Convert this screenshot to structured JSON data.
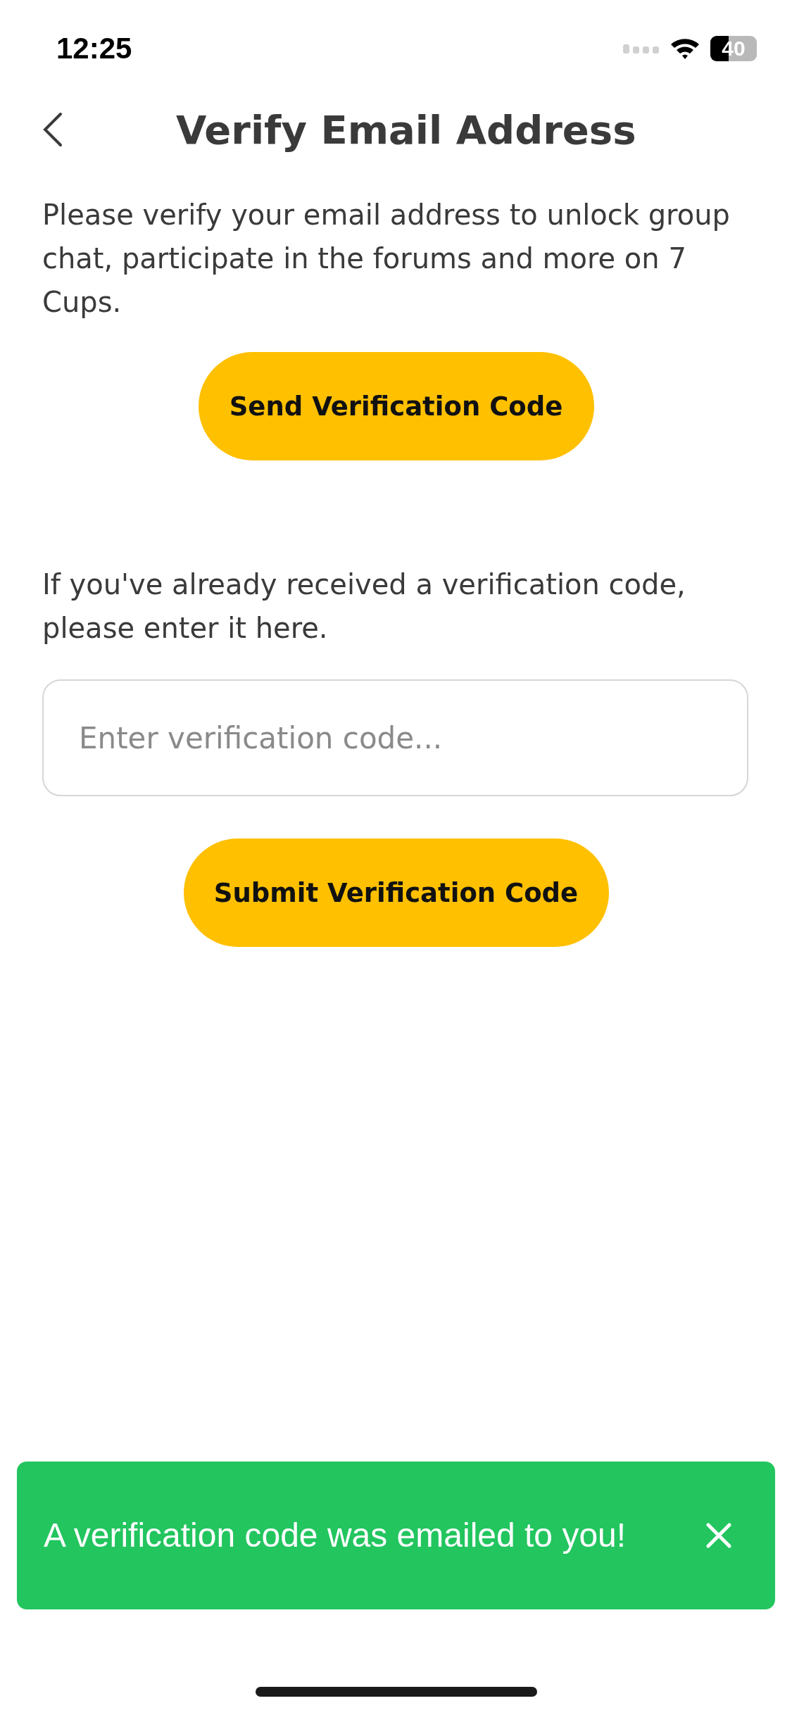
{
  "status_bar": {
    "time": "12:25",
    "battery": "40"
  },
  "header": {
    "title": "Verify Email Address"
  },
  "intro": "Please verify your email address to unlock group chat, participate in the forums and more on 7 Cups.",
  "send_button": "Send Verification Code",
  "code_prompt": "If you've already received a verification code, please enter it here.",
  "code_field": {
    "placeholder": "Enter verification code..."
  },
  "submit_button": "Submit Verification Code",
  "toast": {
    "message": "A verification code was emailed to you!"
  }
}
